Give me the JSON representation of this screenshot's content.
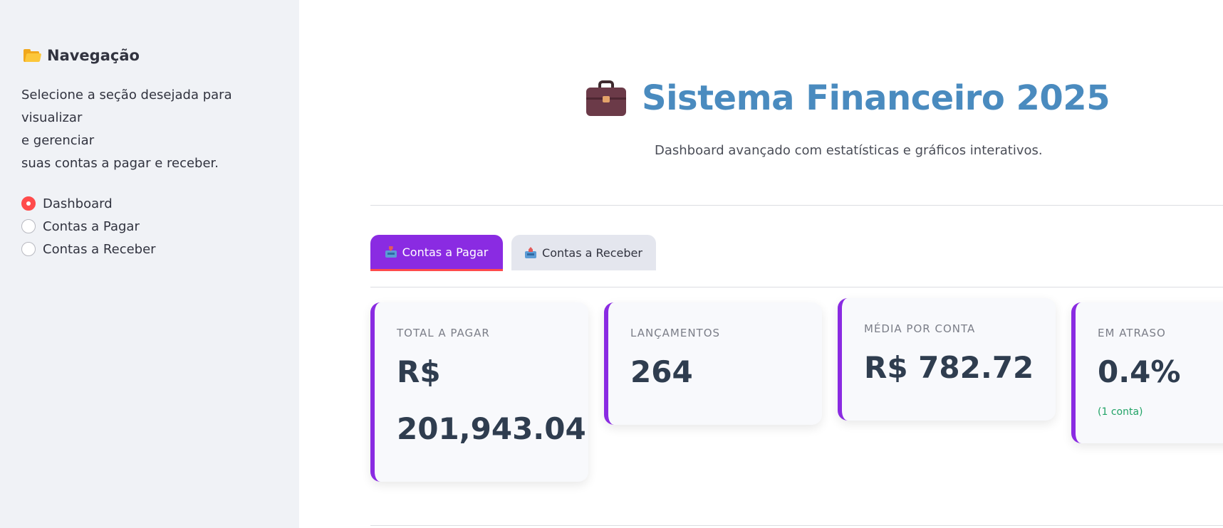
{
  "sidebar": {
    "title": "Navegação",
    "title_icon": "folder-icon",
    "description_lines": [
      "Selecione a seção desejada para visualizar",
      "e gerenciar",
      "suas contas a pagar e receber."
    ],
    "options": [
      {
        "label": "Dashboard",
        "selected": true
      },
      {
        "label": "Contas a Pagar",
        "selected": false
      },
      {
        "label": "Contas a Receber",
        "selected": false
      }
    ]
  },
  "header": {
    "icon": "briefcase-icon",
    "title": "Sistema Financeiro 2025",
    "subtitle": "Dashboard avançado com estatísticas e gráficos interativos."
  },
  "tabs": [
    {
      "label": "Contas a Pagar",
      "icon": "inbox-tray-icon",
      "active": true
    },
    {
      "label": "Contas a Receber",
      "icon": "outbox-tray-icon",
      "active": false
    }
  ],
  "metrics": [
    {
      "label": "TOTAL A PAGAR",
      "value_line1": "R$",
      "value_line2": "201,943.04"
    },
    {
      "label": "LANÇAMENTOS",
      "value": "264"
    },
    {
      "label": "MÉDIA POR CONTA",
      "value": "R$ 782.72"
    },
    {
      "label": "EM ATRASO",
      "value": "0.4%",
      "note": "(1 conta)"
    }
  ],
  "colors": {
    "accent": "#8a2be2",
    "title": "#4a8bbf",
    "radio_selected": "#ff4b4b",
    "tab_underline": "#ff4b4b",
    "note_green": "#21a366",
    "sidebar_bg": "#f0f2f6"
  }
}
